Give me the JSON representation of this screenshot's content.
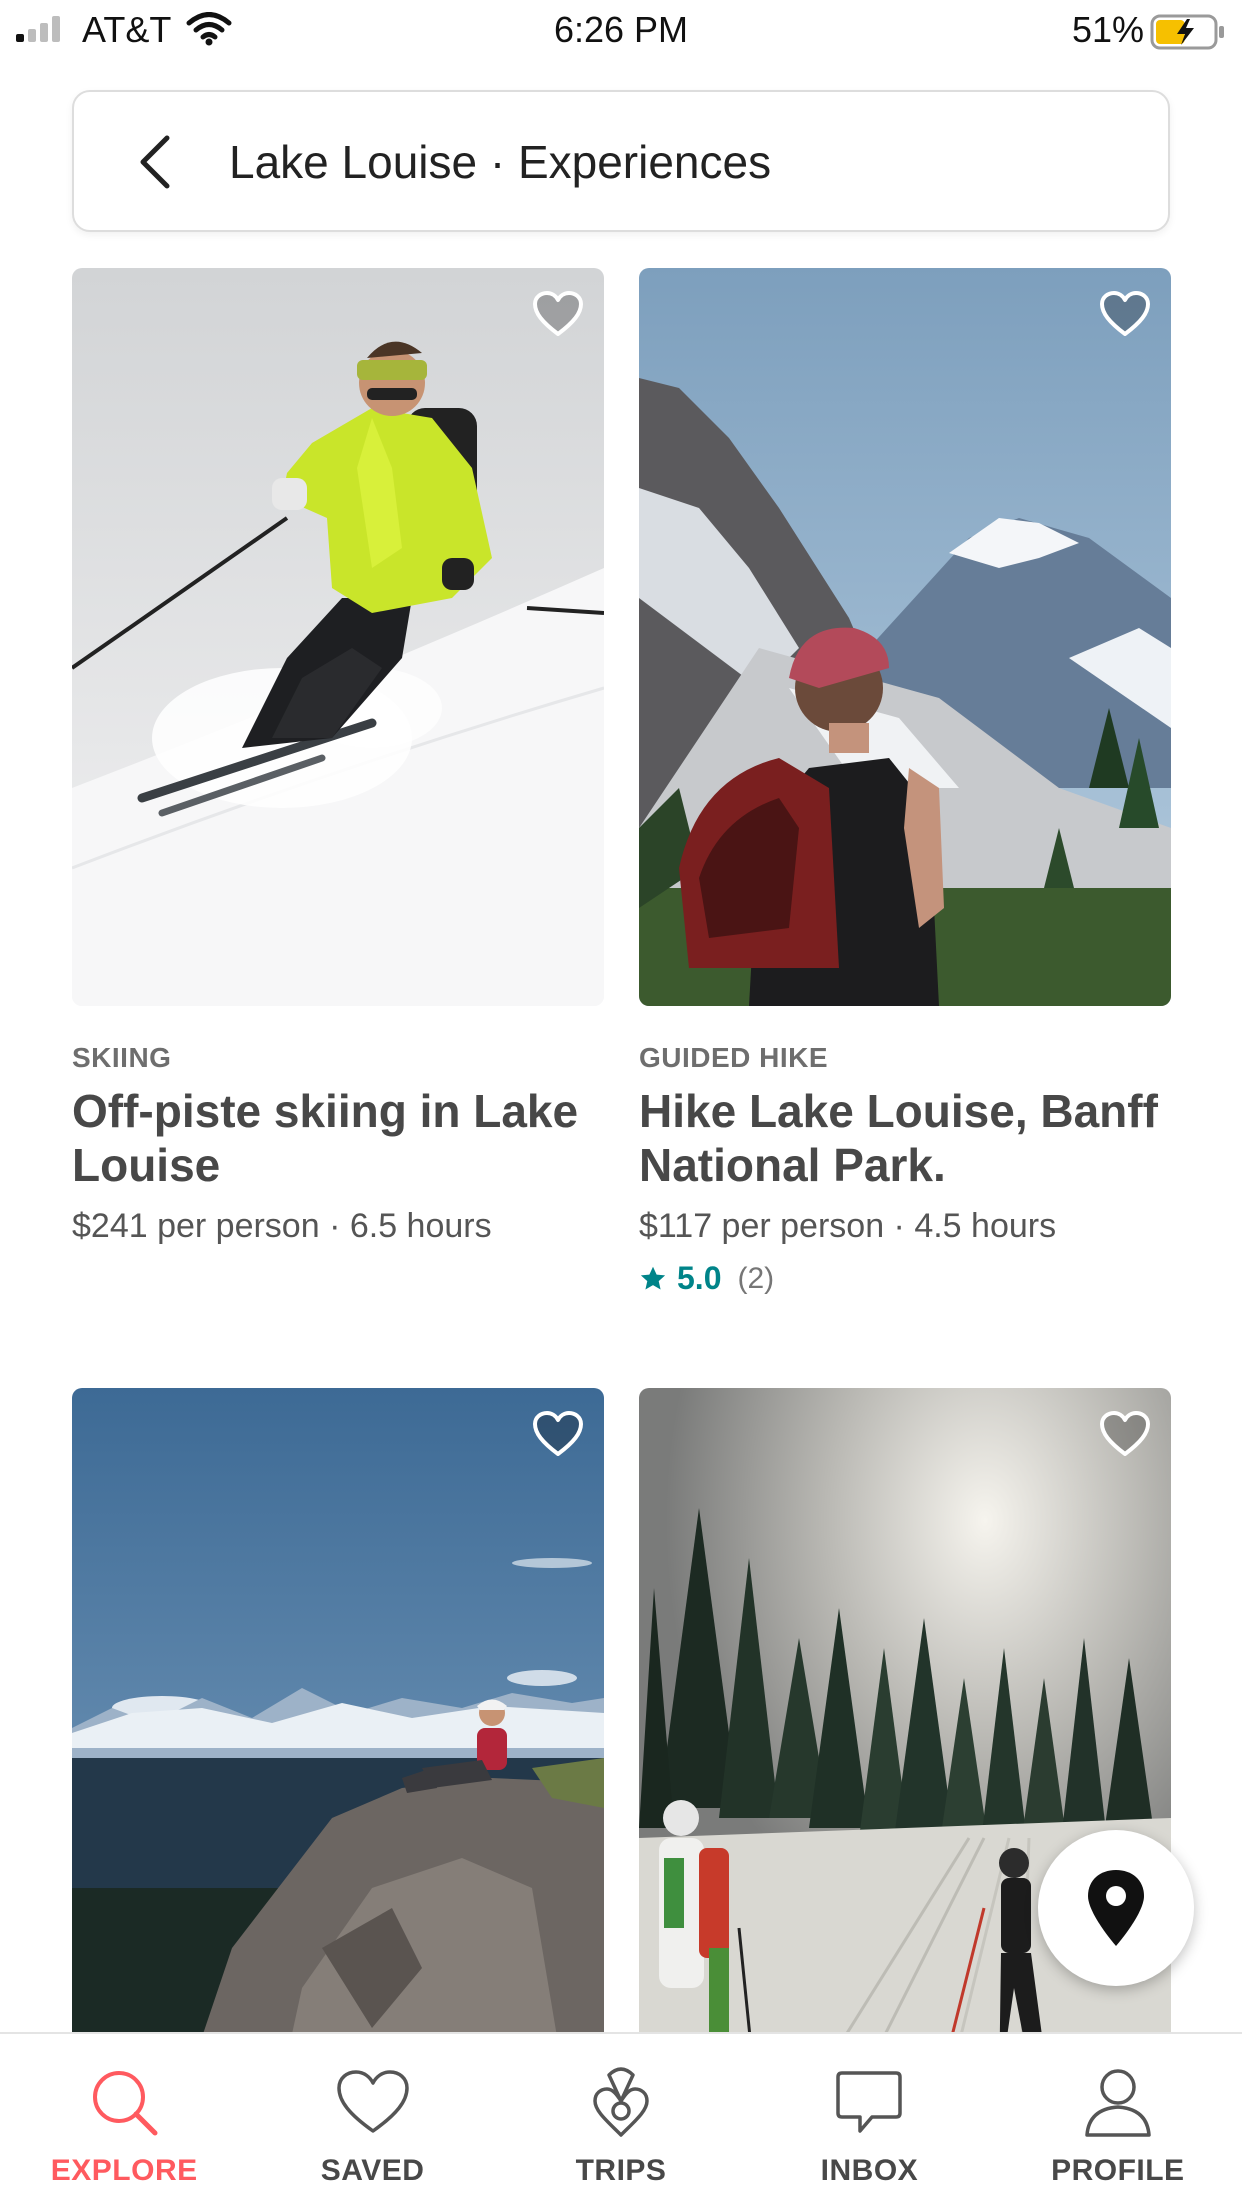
{
  "status_bar": {
    "carrier": "AT&T",
    "time": "6:26 PM",
    "battery_percent": "51%",
    "battery_level": 0.51,
    "signal_bars": 1,
    "charging": true
  },
  "header": {
    "back_icon": "chevron-left-icon",
    "title": "Lake Louise · Experiences"
  },
  "listings": [
    {
      "category": "SKIING",
      "title": "Off-piste skiing in Lake Louise",
      "price": "$241 per person · 6.5 hours",
      "saved": false
    },
    {
      "category": "GUIDED HIKE",
      "title": "Hike Lake Louise, Banff National Park.",
      "price": "$117 per person · 4.5 hours",
      "rating": "5.0",
      "reviews": "(2)",
      "saved": false
    },
    {
      "saved": false
    },
    {
      "saved": false
    }
  ],
  "map_button": {
    "icon": "map-pin-icon"
  },
  "tabs": [
    {
      "label": "EXPLORE",
      "icon": "search-icon",
      "active": true
    },
    {
      "label": "SAVED",
      "icon": "heart-icon",
      "active": false
    },
    {
      "label": "TRIPS",
      "icon": "airbnb-logo-icon",
      "active": false
    },
    {
      "label": "INBOX",
      "icon": "chat-bubble-icon",
      "active": false
    },
    {
      "label": "PROFILE",
      "icon": "person-icon",
      "active": false
    }
  ],
  "colors": {
    "accent": "#FF5A5F",
    "rating": "#008489",
    "text": "#484848",
    "muted": "#767676"
  }
}
